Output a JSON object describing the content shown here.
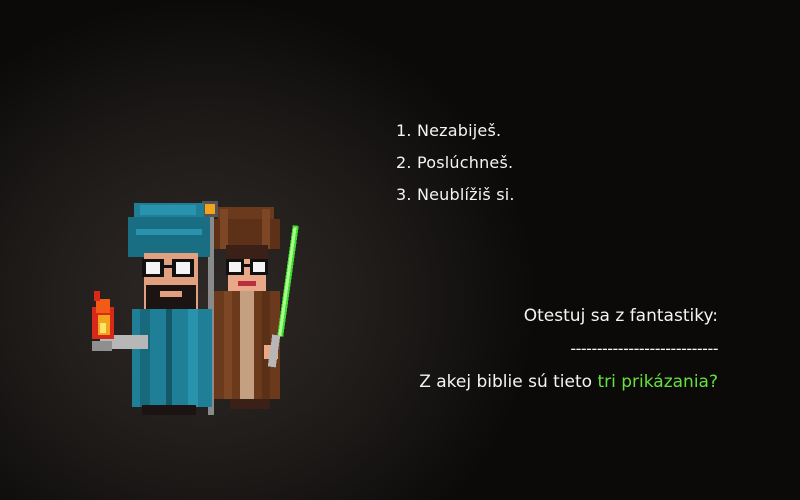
{
  "commandments": [
    "1. Nezabiješ.",
    "2. Poslúchneš.",
    "3. Neublížiš si."
  ],
  "quiz": {
    "heading": "Otestuj sa z fantastiky:",
    "divider": "----------------------------",
    "question_prefix": "Z akej biblie sú tieto ",
    "question_highlight": "tri prikázania?"
  },
  "characters": [
    {
      "name": "wizard-character",
      "icon": "turban-wizard-with-fire-and-staff"
    },
    {
      "name": "jedi-character",
      "icon": "robed-jedi-with-green-lightsaber"
    }
  ],
  "colors": {
    "background": "#0a0908",
    "text": "#f4f4f4",
    "accent": "#66e03c",
    "turban": "#1f7f96",
    "robe_brown": "#6b3a1c",
    "lightsaber": "#44d931",
    "fire": "#f25a16"
  }
}
